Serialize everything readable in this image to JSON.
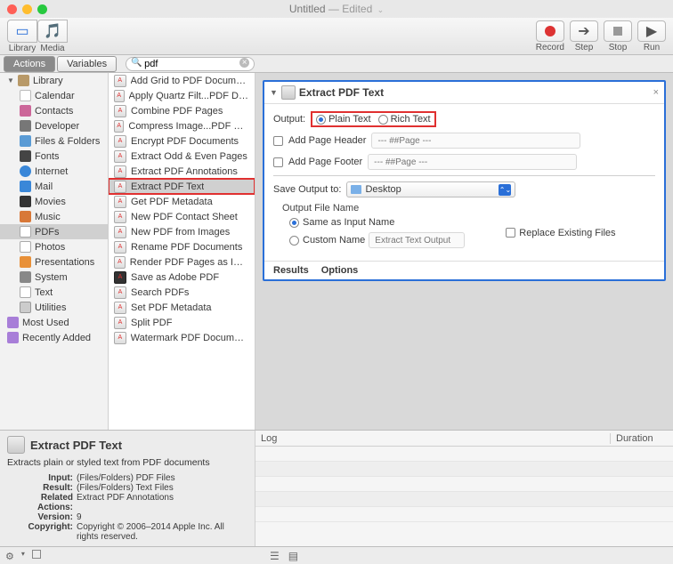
{
  "window": {
    "title": "Untitled",
    "subtitle": "— Edited",
    "arrow": "⌄"
  },
  "toolbar": {
    "library_label": "Library",
    "media_label": "Media",
    "record_label": "Record",
    "step_label": "Step",
    "stop_label": "Stop",
    "run_label": "Run"
  },
  "tabs": {
    "actions": "Actions",
    "variables": "Variables"
  },
  "search": {
    "value": "pdf",
    "clear": "×",
    "icon": "🔍"
  },
  "library": [
    {
      "label": "Library",
      "icon": "ic-lib",
      "disclosure": "▼"
    },
    {
      "label": "Calendar",
      "icon": "ic-cal",
      "indent": true
    },
    {
      "label": "Contacts",
      "icon": "ic-con",
      "indent": true
    },
    {
      "label": "Developer",
      "icon": "ic-dev",
      "indent": true
    },
    {
      "label": "Files & Folders",
      "icon": "ic-fil",
      "indent": true
    },
    {
      "label": "Fonts",
      "icon": "ic-fon",
      "indent": true
    },
    {
      "label": "Internet",
      "icon": "ic-int",
      "indent": true
    },
    {
      "label": "Mail",
      "icon": "ic-mai",
      "indent": true
    },
    {
      "label": "Movies",
      "icon": "ic-mov",
      "indent": true
    },
    {
      "label": "Music",
      "icon": "ic-mus",
      "indent": true
    },
    {
      "label": "PDFs",
      "icon": "ic-pdf",
      "indent": true,
      "selected": true
    },
    {
      "label": "Photos",
      "icon": "ic-pho",
      "indent": true
    },
    {
      "label": "Presentations",
      "icon": "ic-pre",
      "indent": true
    },
    {
      "label": "System",
      "icon": "ic-sys",
      "indent": true
    },
    {
      "label": "Text",
      "icon": "ic-txt",
      "indent": true
    },
    {
      "label": "Utilities",
      "icon": "ic-uti",
      "indent": true
    },
    {
      "label": "Most Used",
      "icon": "ic-mst"
    },
    {
      "label": "Recently Added",
      "icon": "ic-rec"
    }
  ],
  "actions": [
    {
      "label": "Add Grid to PDF Documents"
    },
    {
      "label": "Apply Quartz Filt...PDF Documents"
    },
    {
      "label": "Combine PDF Pages"
    },
    {
      "label": "Compress Image...PDF Documents"
    },
    {
      "label": "Encrypt PDF Documents"
    },
    {
      "label": "Extract Odd & Even Pages"
    },
    {
      "label": "Extract PDF Annotations"
    },
    {
      "label": "Extract PDF Text",
      "selected": true,
      "redbox": true
    },
    {
      "label": "Get PDF Metadata"
    },
    {
      "label": "New PDF Contact Sheet"
    },
    {
      "label": "New PDF from Images"
    },
    {
      "label": "Rename PDF Documents"
    },
    {
      "label": "Render PDF Pages as Images"
    },
    {
      "label": "Save as Adobe PDF",
      "dark": true
    },
    {
      "label": "Search PDFs"
    },
    {
      "label": "Set PDF Metadata"
    },
    {
      "label": "Split PDF"
    },
    {
      "label": "Watermark PDF Documents"
    }
  ],
  "workflow": {
    "title": "Extract PDF Text",
    "close": "×",
    "output_label": "Output:",
    "plain_text": "Plain Text",
    "rich_text": "Rich Text",
    "add_header": "Add Page Header",
    "header_ph": "--- ##Page ---",
    "add_footer": "Add Page Footer",
    "footer_ph": "--- ##Page ---",
    "save_to": "Save Output to:",
    "save_loc": "Desktop",
    "ofn": "Output File Name",
    "same_name": "Same as Input Name",
    "custom_name": "Custom Name",
    "custom_ph": "Extract Text Output",
    "replace": "Replace Existing Files",
    "results": "Results",
    "options": "Options"
  },
  "desc": {
    "title": "Extract PDF Text",
    "sub": "Extracts plain or styled text from PDF documents",
    "rows": [
      {
        "k": "Input:",
        "v": "(Files/Folders) PDF Files"
      },
      {
        "k": "Result:",
        "v": "(Files/Folders) Text Files"
      },
      {
        "k": "Related Actions:",
        "v": "Extract PDF Annotations"
      },
      {
        "k": "Version:",
        "v": "9"
      },
      {
        "k": "Copyright:",
        "v": "Copyright © 2006–2014 Apple Inc. All rights reserved."
      }
    ]
  },
  "log": {
    "col1": "Log",
    "col2": "Duration"
  }
}
